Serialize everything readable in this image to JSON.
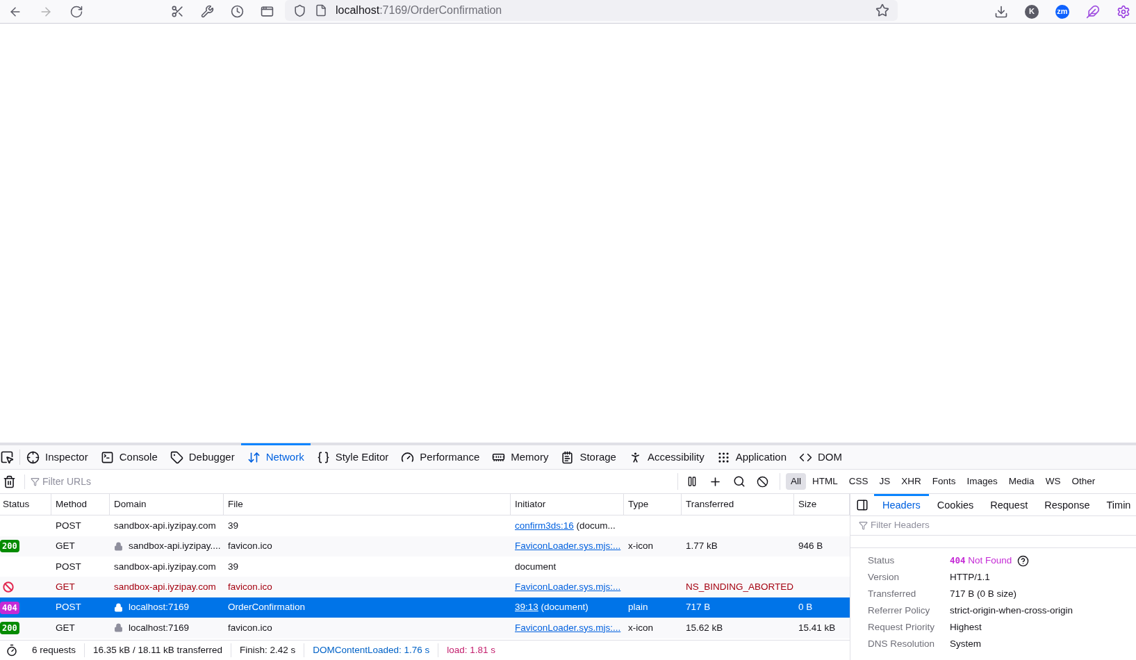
{
  "browser": {
    "nav": [
      {
        "kind": "back",
        "disabled": false
      },
      {
        "kind": "forward",
        "disabled": true
      },
      {
        "kind": "reload",
        "disabled": false
      }
    ],
    "url": {
      "host": "localhost",
      "rest": ":7169/OrderConfirmation"
    },
    "avatars": [
      {
        "text": "K",
        "color": "#5b5b66"
      },
      {
        "text": "zm",
        "color": "#0f62fe"
      }
    ]
  },
  "devtools": {
    "tabs": [
      {
        "label": "Inspector",
        "kind": "inspector",
        "selected": false
      },
      {
        "label": "Console",
        "kind": "console",
        "selected": false
      },
      {
        "label": "Debugger",
        "kind": "debugger",
        "selected": false
      },
      {
        "label": "Network",
        "kind": "network",
        "selected": true
      },
      {
        "label": "Style Editor",
        "kind": "style",
        "selected": false
      },
      {
        "label": "Performance",
        "kind": "performance",
        "selected": false
      },
      {
        "label": "Memory",
        "kind": "memory",
        "selected": false
      },
      {
        "label": "Storage",
        "kind": "storage",
        "selected": false
      },
      {
        "label": "Accessibility",
        "kind": "accessibility",
        "selected": false
      },
      {
        "label": "Application",
        "kind": "application",
        "selected": false
      },
      {
        "label": "DOM",
        "kind": "dom",
        "selected": false
      }
    ],
    "filter": {
      "placeholder": "Filter URLs"
    },
    "type_filters": [
      {
        "label": "All",
        "selected": true
      },
      {
        "label": "HTML",
        "selected": false
      },
      {
        "label": "CSS",
        "selected": false
      },
      {
        "label": "JS",
        "selected": false
      },
      {
        "label": "XHR",
        "selected": false
      },
      {
        "label": "Fonts",
        "selected": false
      },
      {
        "label": "Images",
        "selected": false
      },
      {
        "label": "Media",
        "selected": false
      },
      {
        "label": "WS",
        "selected": false
      },
      {
        "label": "Other",
        "selected": false
      }
    ],
    "table": {
      "columns": [
        "Status",
        "Method",
        "Domain",
        "File",
        "Initiator",
        "Type",
        "Transferred",
        "Size"
      ],
      "rows": [
        {
          "status": {
            "kind": "none"
          },
          "method": "POST",
          "domain": "sandbox-api.iyzipay.com",
          "secure": false,
          "file": "39",
          "initiator_link": "confirm3ds:16",
          "initiator": " (docum...",
          "type": "",
          "transferred": "",
          "size": "",
          "blocked": false,
          "selected": false
        },
        {
          "status": {
            "kind": "code",
            "text": "200",
            "color": "#058b00"
          },
          "method": "GET",
          "domain": "sandbox-api.iyzipay....",
          "secure": true,
          "file": "favicon.ico",
          "initiator_link": "FaviconLoader.sys.mjs:...",
          "initiator": "",
          "type": "x-icon",
          "transferred": "1.77 kB",
          "size": "946 B",
          "blocked": false,
          "selected": false
        },
        {
          "status": {
            "kind": "none"
          },
          "method": "POST",
          "domain": "sandbox-api.iyzipay.com",
          "secure": false,
          "file": "39",
          "initiator_link": "",
          "initiator": "document",
          "type": "",
          "transferred": "",
          "size": "",
          "blocked": false,
          "selected": false
        },
        {
          "status": {
            "kind": "blocked"
          },
          "method": "GET",
          "domain": "sandbox-api.iyzipay.com",
          "secure": false,
          "file": "favicon.ico",
          "initiator_link": "FaviconLoader.sys.mjs:...",
          "initiator": "",
          "type": "",
          "transferred": "NS_BINDING_ABORTED",
          "size": "",
          "blocked": true,
          "selected": false
        },
        {
          "status": {
            "kind": "code",
            "text": "404",
            "color": "#c52bd6"
          },
          "method": "POST",
          "domain": "localhost:7169",
          "secure": true,
          "file": "OrderConfirmation",
          "initiator_link": "39:13",
          "initiator": " (document)",
          "type": "plain",
          "transferred": "717 B",
          "size": "0 B",
          "blocked": false,
          "selected": true
        },
        {
          "status": {
            "kind": "code",
            "text": "200",
            "color": "#058b00"
          },
          "method": "GET",
          "domain": "localhost:7169",
          "secure": true,
          "file": "favicon.ico",
          "initiator_link": "FaviconLoader.sys.mjs:...",
          "initiator": "",
          "type": "x-icon",
          "transferred": "15.62 kB",
          "size": "15.41 kB",
          "blocked": false,
          "selected": false
        }
      ]
    },
    "summary": [
      {
        "text": "6 requests",
        "kind": "plain"
      },
      {
        "text": "16.35 kB / 18.11 kB transferred",
        "kind": "plain"
      },
      {
        "text": "Finish: 2.42 s",
        "kind": "plain"
      },
      {
        "text": "DOMContentLoaded: 1.76 s",
        "kind": "dcl"
      },
      {
        "text": "load: 1.81 s",
        "kind": "load"
      }
    ],
    "details": {
      "tabs": [
        {
          "label": "Headers",
          "selected": true
        },
        {
          "label": "Cookies",
          "selected": false
        },
        {
          "label": "Request",
          "selected": false
        },
        {
          "label": "Response",
          "selected": false
        },
        {
          "label": "Timin",
          "selected": false
        }
      ],
      "filter": {
        "placeholder": "Filter Headers"
      },
      "fields": [
        {
          "label": "Status",
          "kind": "status",
          "code": "404",
          "value": "Not Found"
        },
        {
          "label": "Version",
          "kind": "text",
          "value": "HTTP/1.1"
        },
        {
          "label": "Transferred",
          "kind": "text",
          "value": "717 B (0 B size)"
        },
        {
          "label": "Referrer Policy",
          "kind": "text",
          "value": "strict-origin-when-cross-origin"
        },
        {
          "label": "Request Priority",
          "kind": "text",
          "value": "Highest"
        },
        {
          "label": "DNS Resolution",
          "kind": "text",
          "value": "System"
        }
      ]
    }
  }
}
